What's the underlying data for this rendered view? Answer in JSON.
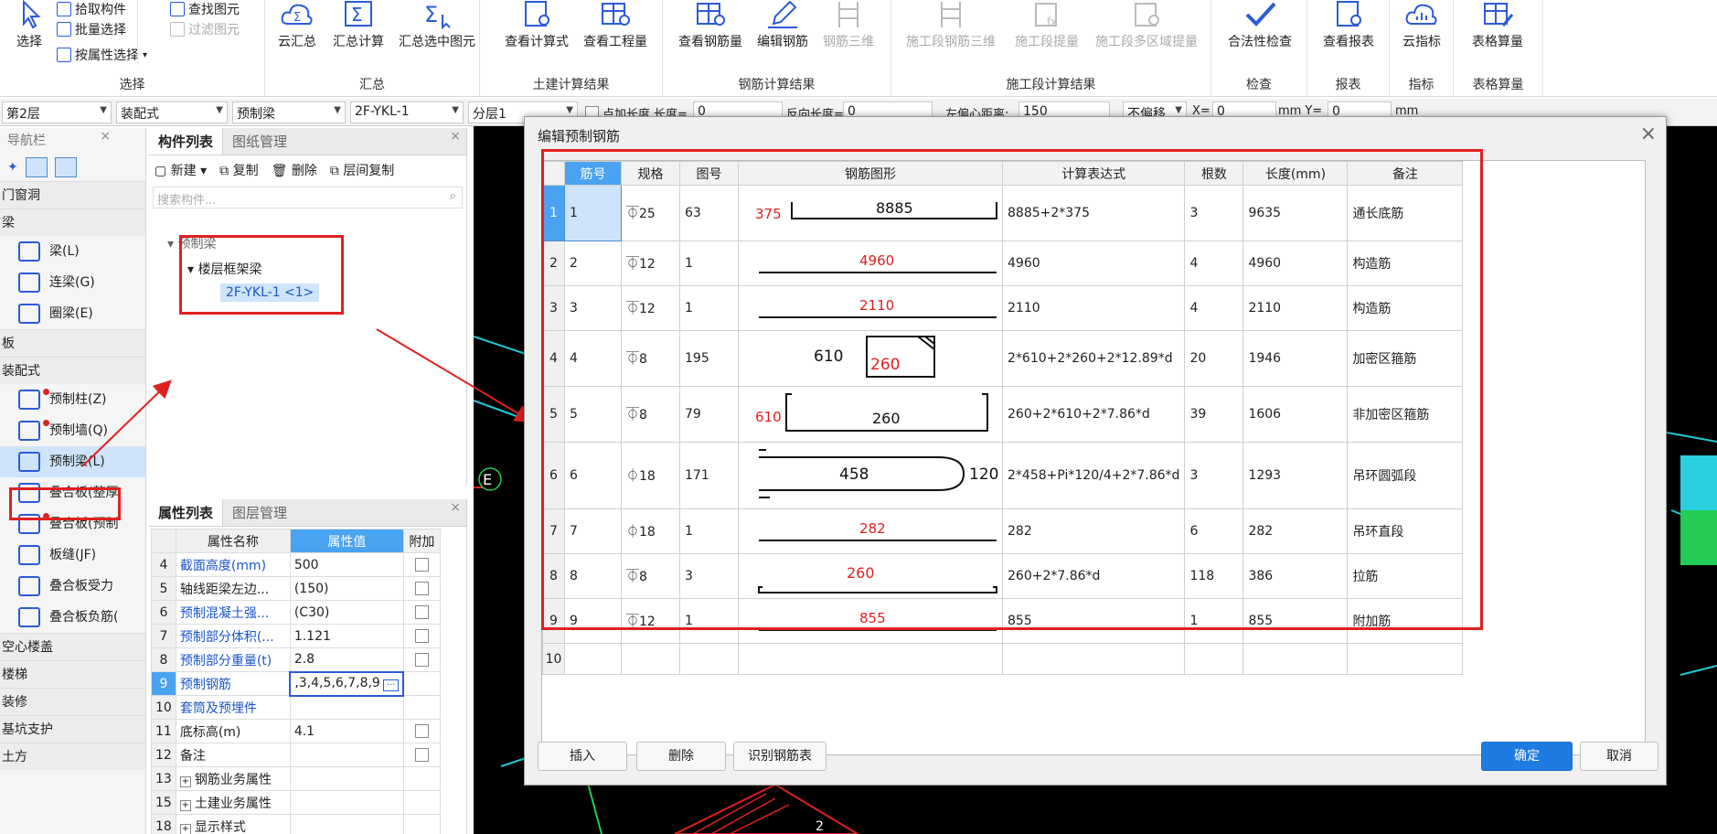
{
  "ribbon": {
    "select": {
      "label": "选择",
      "items": [
        "拾取构件",
        "批量选择",
        "按属性选择"
      ],
      "find": "查找图元",
      "filter": "过滤图元",
      "group": "选择"
    },
    "summary": {
      "buttons": [
        "云汇总",
        "汇总计算",
        "汇总选中图元"
      ],
      "group": "汇总"
    },
    "civil": {
      "buttons": [
        "查看计算式",
        "查看工程量"
      ],
      "group": "土建计算结果"
    },
    "steel": {
      "buttons": [
        "查看钢筋量",
        "编辑钢筋",
        "钢筋三维"
      ],
      "group": "钢筋计算结果"
    },
    "stage": {
      "buttons": [
        "施工段钢筋三维",
        "施工段提量",
        "施工段多区域提量"
      ],
      "group": "施工段计算结果"
    },
    "check": {
      "buttons": [
        "合法性检查"
      ],
      "group": "检查"
    },
    "report": {
      "buttons": [
        "查看报表"
      ],
      "group": "报表"
    },
    "index": {
      "buttons": [
        "云指标"
      ],
      "group": "指标"
    },
    "table": {
      "buttons": [
        "表格算量"
      ],
      "group": "表格算量"
    }
  },
  "toolbar": {
    "floor": "第2层",
    "type": "装配式",
    "comp": "预制梁",
    "name": "2F-YKL-1",
    "layer": "分层1",
    "offset_label": "点加长度",
    "len_label": "长度=",
    "len_val": "0",
    "rev_label": "反向长度=",
    "rev_val": "0",
    "center_label": "左偏心距离:",
    "center_val": "150",
    "nooffset": "不偏移",
    "x_label": "X=",
    "x_val": "0",
    "unit1": "mm",
    "y_label": "Y=",
    "y_val": "0",
    "unit2": "mm"
  },
  "nav": {
    "title": "导航栏",
    "categories": [
      "门窗洞",
      "梁",
      "板",
      "装配式",
      "空心楼盖",
      "楼梯",
      "装修",
      "基坑支护",
      "土方"
    ],
    "beam_items": [
      "梁(L)",
      "连梁(G)",
      "圈梁(E)"
    ],
    "prefab_items": [
      "预制柱(Z)",
      "预制墙(Q)",
      "预制梁(L)",
      "叠合板(整厚",
      "叠合板(预制",
      "板缝(JF)",
      "叠合板受力",
      "叠合板负筋("
    ]
  },
  "complist": {
    "tabs": [
      "构件列表",
      "图纸管理"
    ],
    "tools": [
      "新建",
      "复制",
      "删除",
      "层间复制"
    ],
    "search": "搜索构件...",
    "root": "预制梁",
    "child": "楼层框架梁",
    "leaf": "2F-YKL-1 <1>"
  },
  "props": {
    "tabs": [
      "属性列表",
      "图层管理"
    ],
    "headers": [
      "属性名称",
      "属性值",
      "附加"
    ],
    "rows": [
      {
        "n": "4",
        "name": "截面高度(mm)",
        "val": "500"
      },
      {
        "n": "5",
        "name": "轴线距梁左边...",
        "val": "(150)"
      },
      {
        "n": "6",
        "name": "预制混凝土强...",
        "val": "(C30)"
      },
      {
        "n": "7",
        "name": "预制部分体积(...",
        "val": "1.121"
      },
      {
        "n": "8",
        "name": "预制部分重量(t)",
        "val": "2.8"
      },
      {
        "n": "9",
        "name": "预制钢筋",
        "val": ",3,4,5,6,7,8,9"
      },
      {
        "n": "10",
        "name": "套筒及预埋件",
        "val": ""
      },
      {
        "n": "11",
        "name": "底标高(m)",
        "val": "4.1"
      },
      {
        "n": "12",
        "name": "备注",
        "val": ""
      },
      {
        "n": "13",
        "name": "钢筋业务属性",
        "val": ""
      },
      {
        "n": "15",
        "name": "土建业务属性",
        "val": ""
      },
      {
        "n": "18",
        "name": "显示样式",
        "val": ""
      }
    ]
  },
  "cad": {
    "axis_label": "E",
    "bottom_label": "2"
  },
  "dialog": {
    "title": "编辑预制钢筋",
    "headers": [
      "筋号",
      "规格",
      "图号",
      "钢筋图形",
      "计算表达式",
      "根数",
      "长度(mm)",
      "备注"
    ],
    "rows": [
      {
        "rn": "1",
        "no": "1",
        "spec": "⏁25",
        "fig": "63",
        "shape": "end-hooks",
        "s1": "375",
        "s2": "8885",
        "expr": "8885+2*375",
        "count": "3",
        "len": "9635",
        "note": "通长底筋"
      },
      {
        "rn": "2",
        "no": "2",
        "spec": "⏁12",
        "fig": "1",
        "shape": "straight",
        "s1": "4960",
        "s2": "",
        "expr": "4960",
        "count": "4",
        "len": "4960",
        "note": "构造筋"
      },
      {
        "rn": "3",
        "no": "3",
        "spec": "⏁12",
        "fig": "1",
        "shape": "straight",
        "s1": "2110",
        "s2": "",
        "expr": "2110",
        "count": "4",
        "len": "2110",
        "note": "构造筋"
      },
      {
        "rn": "4",
        "no": "4",
        "spec": "⏁8",
        "fig": "195",
        "shape": "stirrup",
        "s1": "610",
        "s2": "260",
        "expr": "2*610+2*260+2*12.89*d",
        "count": "20",
        "len": "1946",
        "note": "加密区箍筋"
      },
      {
        "rn": "5",
        "no": "5",
        "spec": "⏁8",
        "fig": "79",
        "shape": "u-hooks",
        "s1": "610",
        "s2": "260",
        "expr": "260+2*610+2*7.86*d",
        "count": "39",
        "len": "1606",
        "note": "非加密区箍筋"
      },
      {
        "rn": "6",
        "no": "6",
        "spec": "⏀18",
        "fig": "171",
        "shape": "loop",
        "s1": "458",
        "s2": "120",
        "expr": "2*458+Pi*120/4+2*7.86*d",
        "count": "3",
        "len": "1293",
        "note": "吊环圆弧段"
      },
      {
        "rn": "7",
        "no": "7",
        "spec": "⏀18",
        "fig": "1",
        "shape": "straight",
        "s1": "282",
        "s2": "",
        "expr": "282",
        "count": "6",
        "len": "282",
        "note": "吊环直段"
      },
      {
        "rn": "8",
        "no": "8",
        "spec": "⏁8",
        "fig": "3",
        "shape": "tie",
        "s1": "260",
        "s2": "",
        "expr": "260+2*7.86*d",
        "count": "118",
        "len": "386",
        "note": "拉筋"
      },
      {
        "rn": "9",
        "no": "9",
        "spec": "⏁12",
        "fig": "1",
        "shape": "straight",
        "s1": "855",
        "s2": "",
        "expr": "855",
        "count": "1",
        "len": "855",
        "note": "附加筋"
      },
      {
        "rn": "10",
        "no": "",
        "spec": "",
        "fig": "",
        "shape": "",
        "s1": "",
        "s2": "",
        "expr": "",
        "count": "",
        "len": "",
        "note": ""
      }
    ],
    "buttons": {
      "insert": "插入",
      "delete": "删除",
      "recognize": "识别钢筋表",
      "ok": "确定",
      "cancel": "取消"
    }
  },
  "colors": {
    "accent": "#4aa3f0",
    "highlight_red": "#e02020",
    "primary": "#1e7be0",
    "cad_bg": "#000000"
  }
}
